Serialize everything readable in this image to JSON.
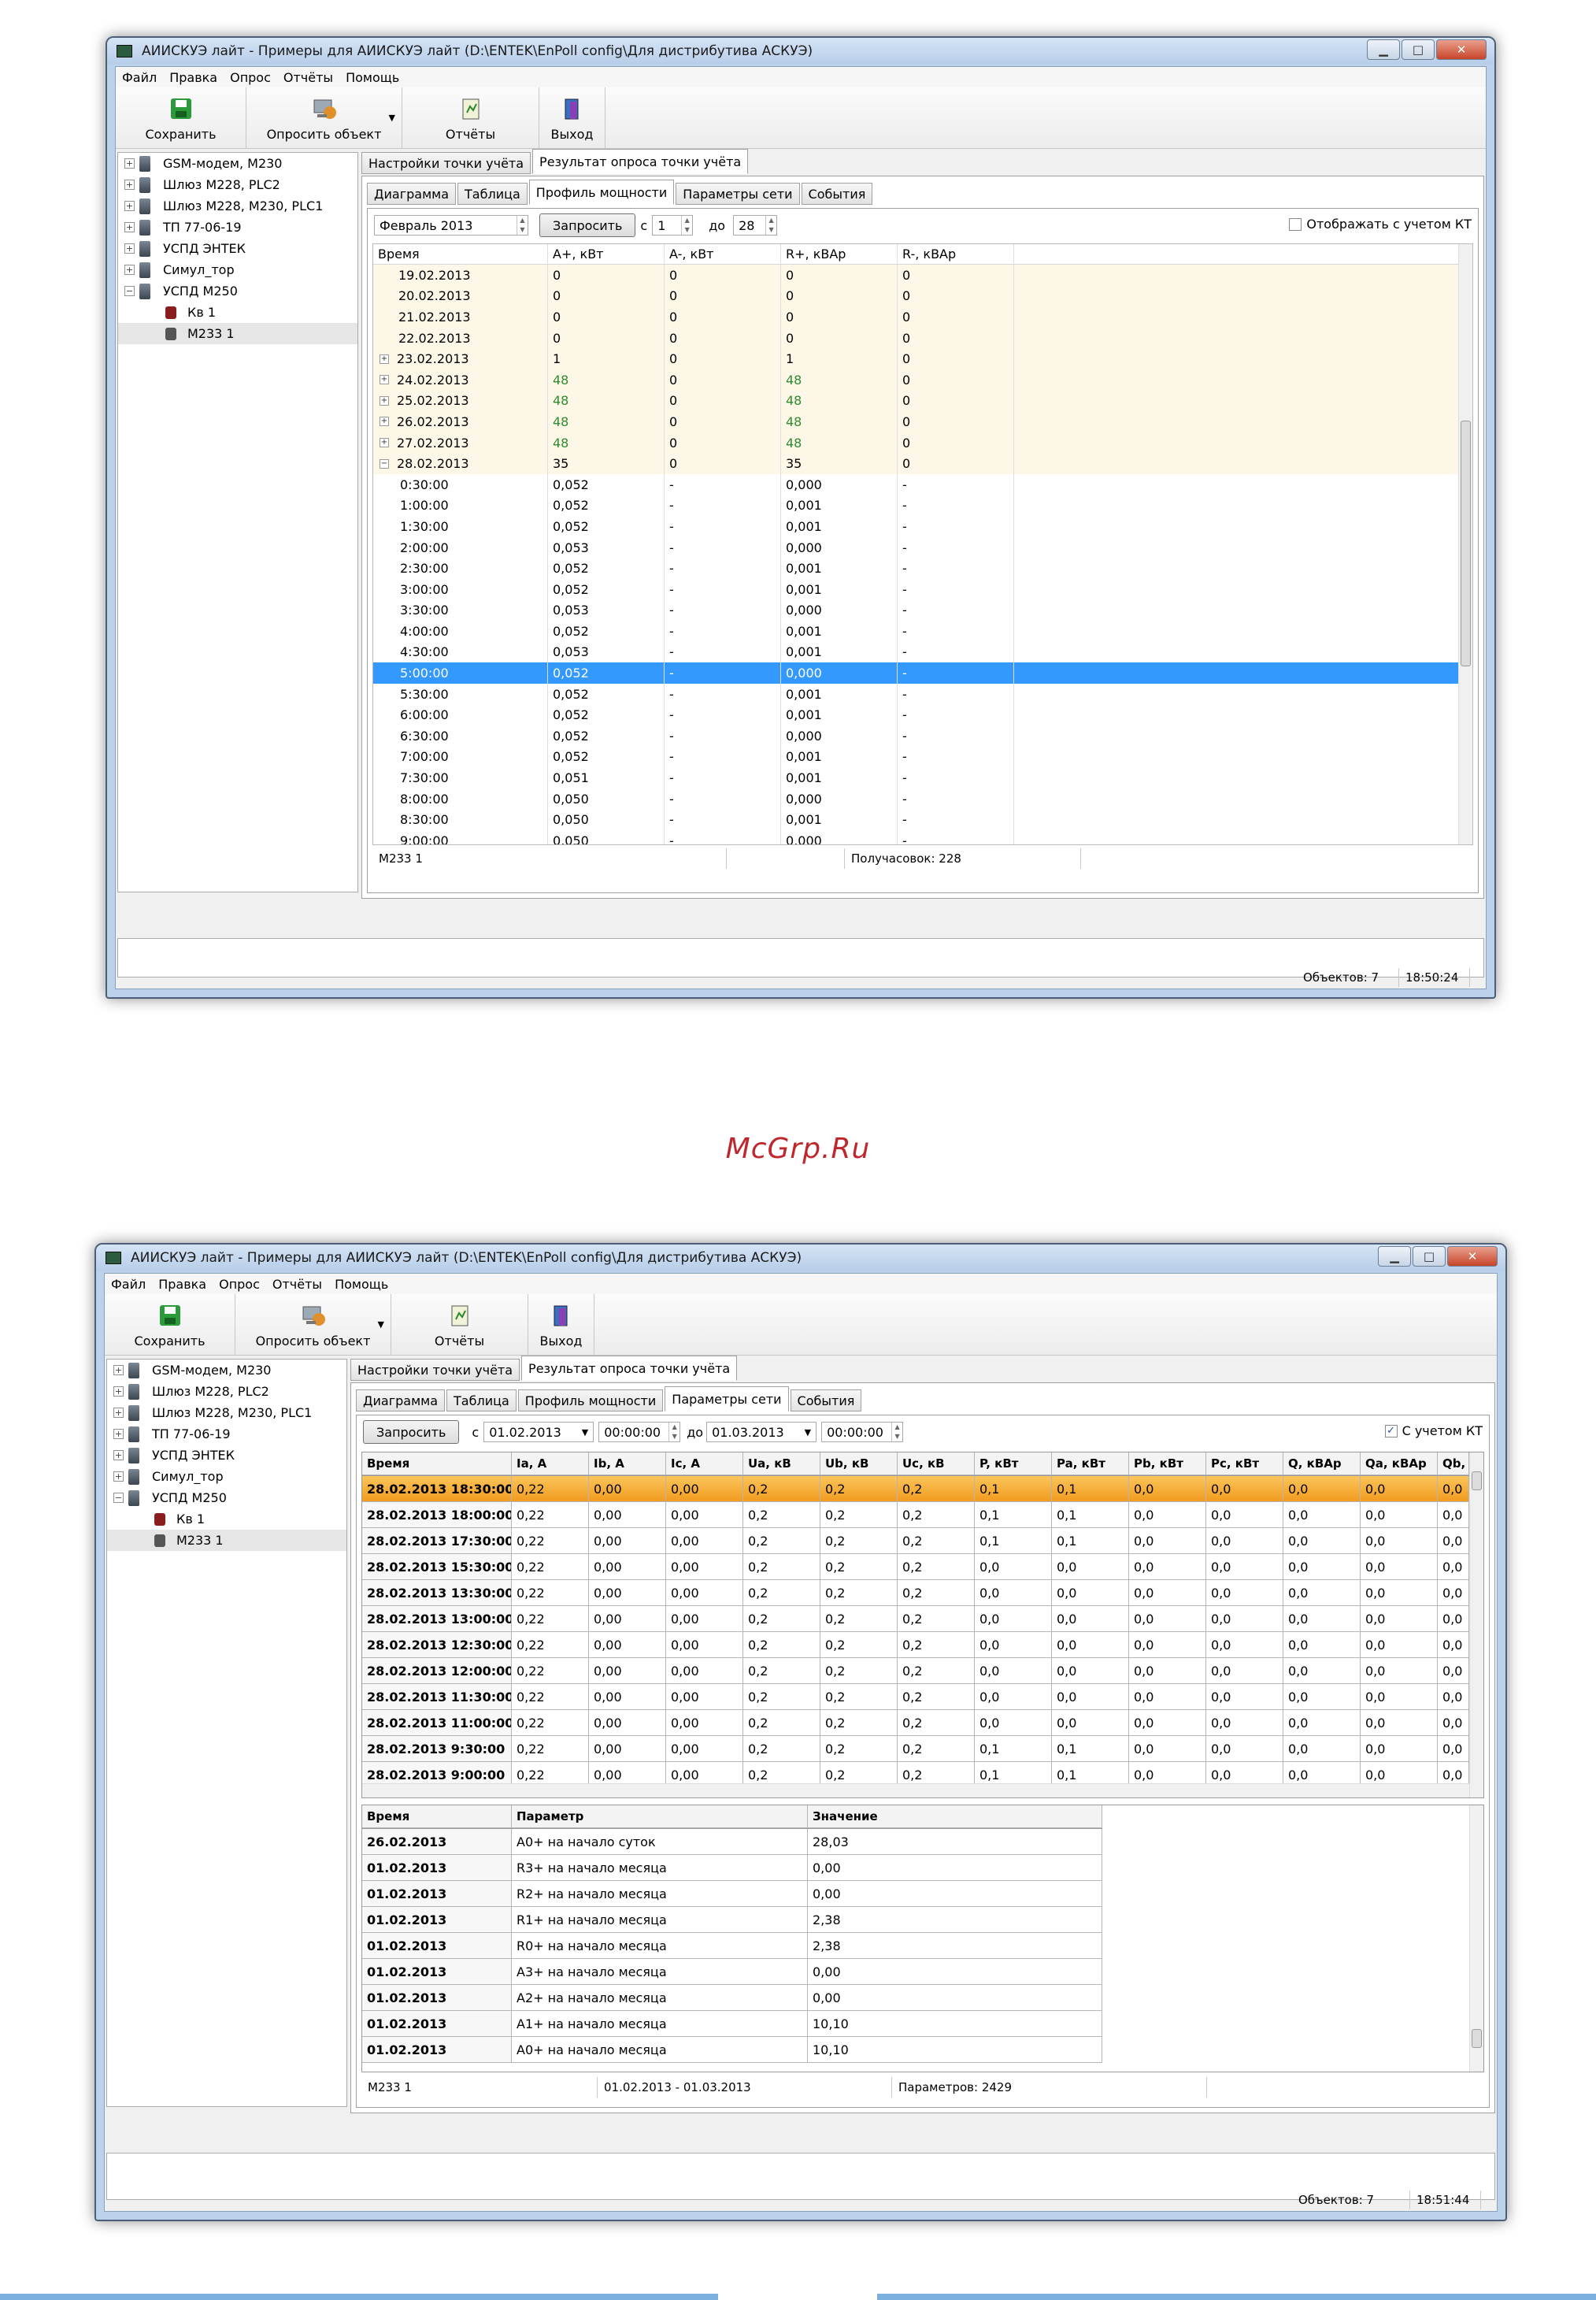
{
  "window": {
    "title": "АИИСКУЭ лайт - Примеры для АИИСКУЭ лайт (D:\\ENTEK\\EnPoll config\\Для дистрибутива АСКУЭ)",
    "minimize": "▁",
    "maximize": "□",
    "close": "✕"
  },
  "menu": [
    "Файл",
    "Правка",
    "Опрос",
    "Отчёты",
    "Помощь"
  ],
  "toolbar": {
    "save": "Сохранить",
    "poll": "Опросить объект",
    "reports": "Отчёты",
    "exit": "Выход"
  },
  "tree": [
    {
      "label": "GSM-модем, М230",
      "expand": "+"
    },
    {
      "label": "Шлюз М228, PLC2",
      "expand": "+"
    },
    {
      "label": "Шлюз М228, М230, PLC1",
      "expand": "+"
    },
    {
      "label": "ТП 77-06-19",
      "expand": "+"
    },
    {
      "label": "УСПД ЭНТЕК",
      "expand": "+"
    },
    {
      "label": "Симул_тор",
      "expand": "+"
    },
    {
      "label": "УСПД М250",
      "expand": "−"
    },
    {
      "label": "Кв 1"
    },
    {
      "label": "М233 1"
    }
  ],
  "outer_tabs": [
    "Настройки точки учёта",
    "Результат опроса точки учёта"
  ],
  "inner_tabs": [
    "Диаграмма",
    "Таблица",
    "Профиль мощности",
    "Параметры сети",
    "События"
  ],
  "s1": {
    "month": "Февраль  2013",
    "request": "Запросить",
    "from_label": "с",
    "from_val": "1",
    "to_label": "до",
    "to_val": "28",
    "kt_label": "Отображать с учетом КТ",
    "headers": [
      "Время",
      "A+, кВт",
      "A-, кВт",
      "R+, кВАр",
      "R-, кВАр"
    ],
    "rows": [
      {
        "t": "19.02.2013",
        "v": [
          "0",
          "0",
          "0",
          "0"
        ],
        "day": true
      },
      {
        "t": "20.02.2013",
        "v": [
          "0",
          "0",
          "0",
          "0"
        ],
        "day": true
      },
      {
        "t": "21.02.2013",
        "v": [
          "0",
          "0",
          "0",
          "0"
        ],
        "day": true
      },
      {
        "t": "22.02.2013",
        "v": [
          "0",
          "0",
          "0",
          "0"
        ],
        "day": true
      },
      {
        "t": "23.02.2013",
        "v": [
          "1",
          "0",
          "1",
          "0"
        ],
        "day": true,
        "exp": "+"
      },
      {
        "t": "24.02.2013",
        "v": [
          "48",
          "0",
          "48",
          "0"
        ],
        "day": true,
        "exp": "+",
        "green": true
      },
      {
        "t": "25.02.2013",
        "v": [
          "48",
          "0",
          "48",
          "0"
        ],
        "day": true,
        "exp": "+",
        "green": true
      },
      {
        "t": "26.02.2013",
        "v": [
          "48",
          "0",
          "48",
          "0"
        ],
        "day": true,
        "exp": "+",
        "green": true
      },
      {
        "t": "27.02.2013",
        "v": [
          "48",
          "0",
          "48",
          "0"
        ],
        "day": true,
        "exp": "+",
        "green": true
      },
      {
        "t": "28.02.2013",
        "v": [
          "35",
          "0",
          "35",
          "0"
        ],
        "day": true,
        "exp": "−"
      },
      {
        "t": "0:30:00",
        "v": [
          "0,052",
          "-",
          "0,000",
          "-"
        ]
      },
      {
        "t": "1:00:00",
        "v": [
          "0,052",
          "-",
          "0,001",
          "-"
        ]
      },
      {
        "t": "1:30:00",
        "v": [
          "0,052",
          "-",
          "0,001",
          "-"
        ]
      },
      {
        "t": "2:00:00",
        "v": [
          "0,053",
          "-",
          "0,000",
          "-"
        ]
      },
      {
        "t": "2:30:00",
        "v": [
          "0,052",
          "-",
          "0,001",
          "-"
        ]
      },
      {
        "t": "3:00:00",
        "v": [
          "0,052",
          "-",
          "0,001",
          "-"
        ]
      },
      {
        "t": "3:30:00",
        "v": [
          "0,053",
          "-",
          "0,000",
          "-"
        ]
      },
      {
        "t": "4:00:00",
        "v": [
          "0,052",
          "-",
          "0,001",
          "-"
        ]
      },
      {
        "t": "4:30:00",
        "v": [
          "0,053",
          "-",
          "0,001",
          "-"
        ]
      },
      {
        "t": "5:00:00",
        "v": [
          "0,052",
          "-",
          "0,000",
          "-"
        ],
        "sel": true
      },
      {
        "t": "5:30:00",
        "v": [
          "0,052",
          "-",
          "0,001",
          "-"
        ]
      },
      {
        "t": "6:00:00",
        "v": [
          "0,052",
          "-",
          "0,001",
          "-"
        ]
      },
      {
        "t": "6:30:00",
        "v": [
          "0,052",
          "-",
          "0,000",
          "-"
        ]
      },
      {
        "t": "7:00:00",
        "v": [
          "0,052",
          "-",
          "0,001",
          "-"
        ]
      },
      {
        "t": "7:30:00",
        "v": [
          "0,051",
          "-",
          "0,001",
          "-"
        ]
      },
      {
        "t": "8:00:00",
        "v": [
          "0,050",
          "-",
          "0,000",
          "-"
        ]
      },
      {
        "t": "8:30:00",
        "v": [
          "0,050",
          "-",
          "0,001",
          "-"
        ]
      },
      {
        "t": "9:00:00",
        "v": [
          "0,050",
          "-",
          "0,000",
          "-"
        ]
      }
    ],
    "status_left": "М233 1",
    "status_mid": "",
    "status_right": "Получасовок: 228",
    "objects": "Объектов: 7",
    "time": "18:50:24"
  },
  "watermark": "McGrp.Ru",
  "s2": {
    "request": "Запросить",
    "from_label": "с",
    "from_date": "01.02.2013",
    "from_time": "00:00:00",
    "to_label": "до",
    "to_date": "01.03.2013",
    "to_time": "00:00:00",
    "kt_label": "С учетом КТ",
    "kt_checked": "✓",
    "headers": [
      "Время",
      "Ia, A",
      "Ib, A",
      "Ic, A",
      "Ua, кВ",
      "Ub, кВ",
      "Uc, кВ",
      "P, кВт",
      "Pa, кВт",
      "Pb, кВт",
      "Pc, кВт",
      "Q, кВАр",
      "Qa, кВАр",
      "Qb,"
    ],
    "rows": [
      {
        "t": "28.02.2013 18:30:00",
        "v": [
          "0,22",
          "0,00",
          "0,00",
          "0,2",
          "0,2",
          "0,2",
          "0,1",
          "0,1",
          "0,0",
          "0,0",
          "0,0",
          "0,0",
          "0,0"
        ],
        "sel": true
      },
      {
        "t": "28.02.2013 18:00:00",
        "v": [
          "0,22",
          "0,00",
          "0,00",
          "0,2",
          "0,2",
          "0,2",
          "0,1",
          "0,1",
          "0,0",
          "0,0",
          "0,0",
          "0,0",
          "0,0"
        ]
      },
      {
        "t": "28.02.2013 17:30:00",
        "v": [
          "0,22",
          "0,00",
          "0,00",
          "0,2",
          "0,2",
          "0,2",
          "0,1",
          "0,1",
          "0,0",
          "0,0",
          "0,0",
          "0,0",
          "0,0"
        ]
      },
      {
        "t": "28.02.2013 15:30:00",
        "v": [
          "0,22",
          "0,00",
          "0,00",
          "0,2",
          "0,2",
          "0,2",
          "0,0",
          "0,0",
          "0,0",
          "0,0",
          "0,0",
          "0,0",
          "0,0"
        ]
      },
      {
        "t": "28.02.2013 13:30:00",
        "v": [
          "0,22",
          "0,00",
          "0,00",
          "0,2",
          "0,2",
          "0,2",
          "0,0",
          "0,0",
          "0,0",
          "0,0",
          "0,0",
          "0,0",
          "0,0"
        ]
      },
      {
        "t": "28.02.2013 13:00:00",
        "v": [
          "0,22",
          "0,00",
          "0,00",
          "0,2",
          "0,2",
          "0,2",
          "0,0",
          "0,0",
          "0,0",
          "0,0",
          "0,0",
          "0,0",
          "0,0"
        ]
      },
      {
        "t": "28.02.2013 12:30:00",
        "v": [
          "0,22",
          "0,00",
          "0,00",
          "0,2",
          "0,2",
          "0,2",
          "0,0",
          "0,0",
          "0,0",
          "0,0",
          "0,0",
          "0,0",
          "0,0"
        ]
      },
      {
        "t": "28.02.2013 12:00:00",
        "v": [
          "0,22",
          "0,00",
          "0,00",
          "0,2",
          "0,2",
          "0,2",
          "0,0",
          "0,0",
          "0,0",
          "0,0",
          "0,0",
          "0,0",
          "0,0"
        ]
      },
      {
        "t": "28.02.2013 11:30:00",
        "v": [
          "0,22",
          "0,00",
          "0,00",
          "0,2",
          "0,2",
          "0,2",
          "0,0",
          "0,0",
          "0,0",
          "0,0",
          "0,0",
          "0,0",
          "0,0"
        ]
      },
      {
        "t": "28.02.2013 11:00:00",
        "v": [
          "0,22",
          "0,00",
          "0,00",
          "0,2",
          "0,2",
          "0,2",
          "0,0",
          "0,0",
          "0,0",
          "0,0",
          "0,0",
          "0,0",
          "0,0"
        ]
      },
      {
        "t": "28.02.2013 9:30:00",
        "v": [
          "0,22",
          "0,00",
          "0,00",
          "0,2",
          "0,2",
          "0,2",
          "0,1",
          "0,1",
          "0,0",
          "0,0",
          "0,0",
          "0,0",
          "0,0"
        ]
      },
      {
        "t": "28.02.2013 9:00:00",
        "v": [
          "0,22",
          "0,00",
          "0,00",
          "0,2",
          "0,2",
          "0,2",
          "0,1",
          "0,1",
          "0,0",
          "0,0",
          "0,0",
          "0,0",
          "0,0"
        ]
      }
    ],
    "params_headers": [
      "Время",
      "Параметр",
      "Значение"
    ],
    "params": [
      [
        "26.02.2013",
        "A0+ на начало суток",
        "28,03"
      ],
      [
        "01.02.2013",
        "R3+ на начало месяца",
        "0,00"
      ],
      [
        "01.02.2013",
        "R2+ на начало месяца",
        "0,00"
      ],
      [
        "01.02.2013",
        "R1+ на начало месяца",
        "2,38"
      ],
      [
        "01.02.2013",
        "R0+ на начало месяца",
        "2,38"
      ],
      [
        "01.02.2013",
        "A3+ на начало месяца",
        "0,00"
      ],
      [
        "01.02.2013",
        "A2+ на начало месяца",
        "0,00"
      ],
      [
        "01.02.2013",
        "A1+ на начало месяца",
        "10,10"
      ],
      [
        "01.02.2013",
        "A0+ на начало месяца",
        "10,10"
      ]
    ],
    "status_left": "М233 1",
    "status_mid": "01.02.2013 - 01.03.2013",
    "status_right": "Параметров: 2429",
    "objects": "Объектов: 7",
    "time": "18:51:44"
  }
}
